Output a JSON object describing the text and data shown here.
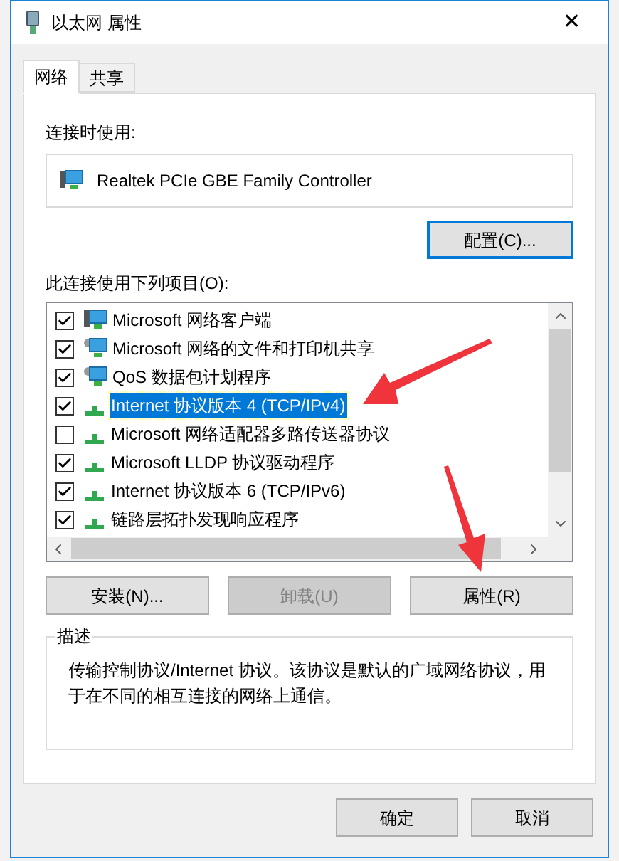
{
  "window": {
    "title": "以太网 属性",
    "close": "✕"
  },
  "tabs": [
    {
      "label": "网络",
      "selected": true
    },
    {
      "label": "共享",
      "selected": false
    }
  ],
  "connect_using": {
    "label": "连接时使用:",
    "adapter": "Realtek PCIe GBE Family Controller"
  },
  "configure_button": "配置(C)...",
  "items_label": "此连接使用下列项目(O):",
  "items": [
    {
      "kind": "client",
      "label": "Microsoft 网络客户端",
      "checked": true,
      "selected": false
    },
    {
      "kind": "service",
      "label": "Microsoft 网络的文件和打印机共享",
      "checked": true,
      "selected": false
    },
    {
      "kind": "service",
      "label": "QoS 数据包计划程序",
      "checked": true,
      "selected": false
    },
    {
      "kind": "protocol",
      "label": "Internet 协议版本 4 (TCP/IPv4)",
      "checked": true,
      "selected": true
    },
    {
      "kind": "protocol",
      "label": "Microsoft 网络适配器多路传送器协议",
      "checked": false,
      "selected": false
    },
    {
      "kind": "protocol",
      "label": "Microsoft LLDP 协议驱动程序",
      "checked": true,
      "selected": false
    },
    {
      "kind": "protocol",
      "label": "Internet 协议版本 6 (TCP/IPv6)",
      "checked": true,
      "selected": false
    },
    {
      "kind": "protocol",
      "label": "链路层拓扑发现响应程序",
      "checked": true,
      "selected": false
    }
  ],
  "item_buttons": [
    {
      "label": "安装(N)...",
      "disabled": false
    },
    {
      "label": "卸载(U)",
      "disabled": true
    },
    {
      "label": "属性(R)",
      "disabled": false
    }
  ],
  "description": {
    "legend": "描述",
    "text": "传输控制协议/Internet 协议。该协议是默认的广域网络协议，用于在不同的相互连接的网络上通信。"
  },
  "footer_buttons": [
    "确定",
    "取消"
  ]
}
